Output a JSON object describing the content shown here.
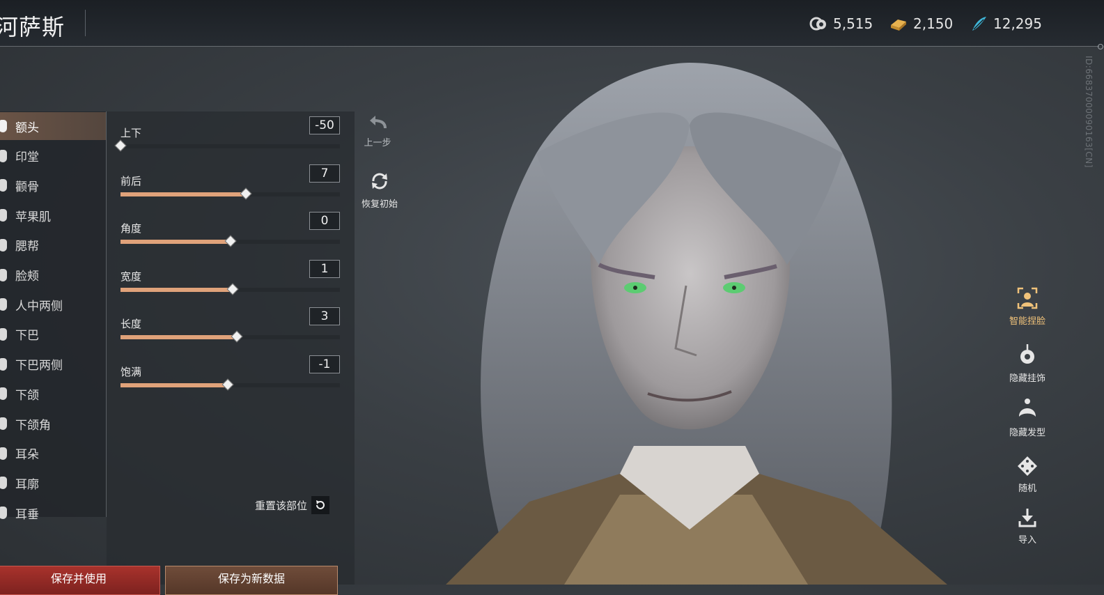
{
  "header": {
    "title": "河萨斯"
  },
  "currencies": [
    {
      "icon": "spirit-coin-icon",
      "value": "5,515"
    },
    {
      "icon": "gold-ingot-icon",
      "value": "2,150"
    },
    {
      "icon": "feather-icon",
      "value": "12,295"
    }
  ],
  "player_id": "ID:66837000090163[CN]",
  "categories": [
    {
      "label": "额头",
      "active": true
    },
    {
      "label": "印堂"
    },
    {
      "label": "颧骨"
    },
    {
      "label": "苹果肌"
    },
    {
      "label": "腮帮"
    },
    {
      "label": "脸颊"
    },
    {
      "label": "人中两侧"
    },
    {
      "label": "下巴"
    },
    {
      "label": "下巴两侧"
    },
    {
      "label": "下颌"
    },
    {
      "label": "下颌角"
    },
    {
      "label": "耳朵"
    },
    {
      "label": "耳廓"
    },
    {
      "label": "耳垂"
    }
  ],
  "sliders": [
    {
      "label": "上下",
      "value": "-50",
      "fraction": 0.0
    },
    {
      "label": "前后",
      "value": "7",
      "fraction": 0.57
    },
    {
      "label": "角度",
      "value": "0",
      "fraction": 0.5
    },
    {
      "label": "宽度",
      "value": "1",
      "fraction": 0.51
    },
    {
      "label": "长度",
      "value": "3",
      "fraction": 0.53
    },
    {
      "label": "饱满",
      "value": "-1",
      "fraction": 0.49
    }
  ],
  "reset_part_label": "重置该部位",
  "tools": {
    "undo": "上一步",
    "restore": "恢复初始"
  },
  "right_tools": {
    "smart_face": "智能捏脸",
    "hide_accessory": "隐藏挂饰",
    "hide_hair": "隐藏发型",
    "random": "随机",
    "import": "导入"
  },
  "bottom": {
    "save": "保存并使用",
    "save_data": "保存为新数据"
  },
  "colors": {
    "accent": "#e0a27a",
    "active_tab": "#6a5446",
    "save_button": "#a8322c"
  }
}
